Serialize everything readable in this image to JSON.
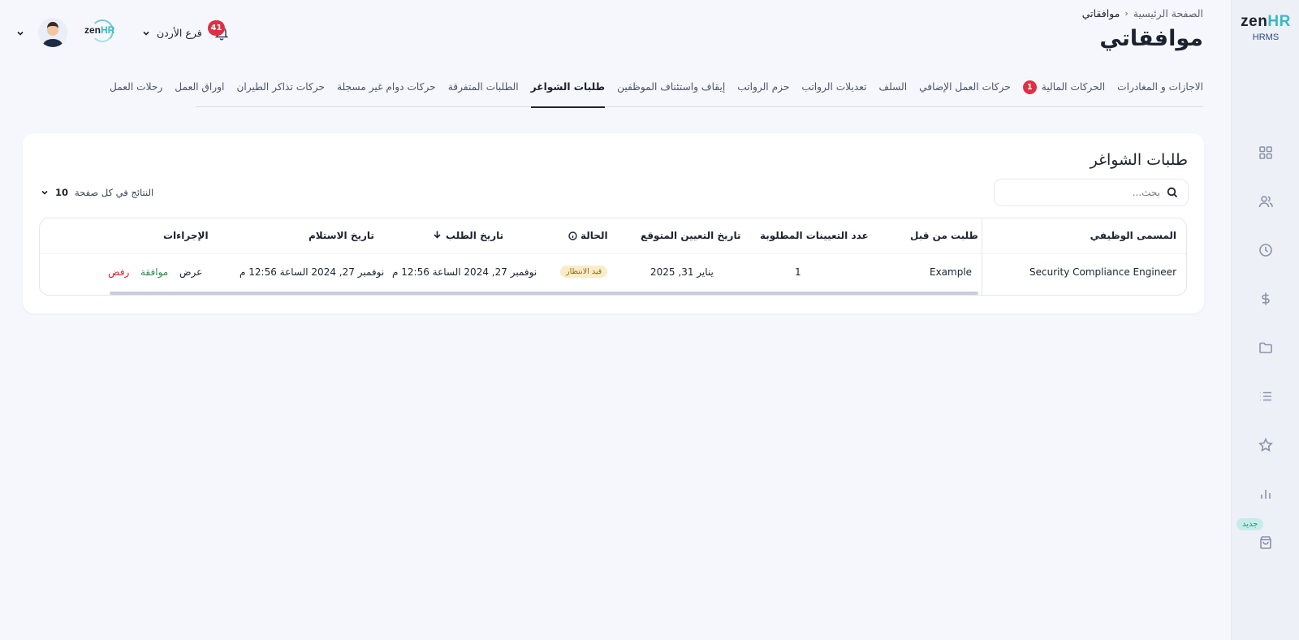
{
  "sidebar": {
    "brand_zen": "zen",
    "brand_hr": "HR",
    "brand_sub": "HRMS",
    "new_badge": "جديد",
    "icons": [
      "dashboard-icon",
      "users-icon",
      "clock-icon",
      "dollar-icon",
      "folder-icon",
      "list-icon",
      "star-icon",
      "bar-chart-icon",
      "bag-icon"
    ]
  },
  "header": {
    "breadcrumb_home": "الصفحة الرئيسية",
    "breadcrumb_current": "موافقاتي",
    "title": "موافقاتي",
    "branch": "فرع الأردن",
    "notifications_count": "41",
    "company_logo_zen": "zen",
    "company_logo_hr": "HR"
  },
  "tabs": [
    {
      "label": "الاجازات و المغادرات"
    },
    {
      "label": "الحركات المالية",
      "badge": "1"
    },
    {
      "label": "حركات العمل الإضافي"
    },
    {
      "label": "السلف"
    },
    {
      "label": "تعديلات الرواتب"
    },
    {
      "label": "حزم الرواتب"
    },
    {
      "label": "إيقاف واستئناف الموظفين"
    },
    {
      "label": "طلبات الشواغر",
      "active": true
    },
    {
      "label": "الطلبات المتفرقة"
    },
    {
      "label": "حركات دوام غير مسجلة"
    },
    {
      "label": "حركات تذاكر الطيران"
    },
    {
      "label": "اوراق العمل"
    },
    {
      "label": "رحلات العمل"
    }
  ],
  "card": {
    "title": "طلبات الشواغر",
    "search_placeholder": "بحث...",
    "per_page_label": "النتائج في كل صفحة",
    "per_page_value": "10"
  },
  "table": {
    "headers": {
      "job_title": "المسمى الوظيفي",
      "requested_by": "طلبت من قبل",
      "openings": "عدد التعيينات المطلوبة",
      "expected_date": "تاريخ التعيين المتوقع",
      "status": "الحالة",
      "request_date": "تاريخ الطلب",
      "received_date": "تاريخ الاستلام",
      "actions": "الإجراءات"
    },
    "rows": [
      {
        "job_title": "Security Compliance Engineer",
        "requested_by": "Example",
        "openings": "1",
        "expected_date": "يناير 31, 2025",
        "status": "قيد الانتظار",
        "request_date": "نوفمبر 27, 2024 الساعة 12:56 م",
        "received_date": "نوفمبر 27, 2024 الساعة 12:56 م",
        "action_view": "عرض",
        "action_approve": "موافقة",
        "action_reject": "رفض"
      }
    ]
  }
}
